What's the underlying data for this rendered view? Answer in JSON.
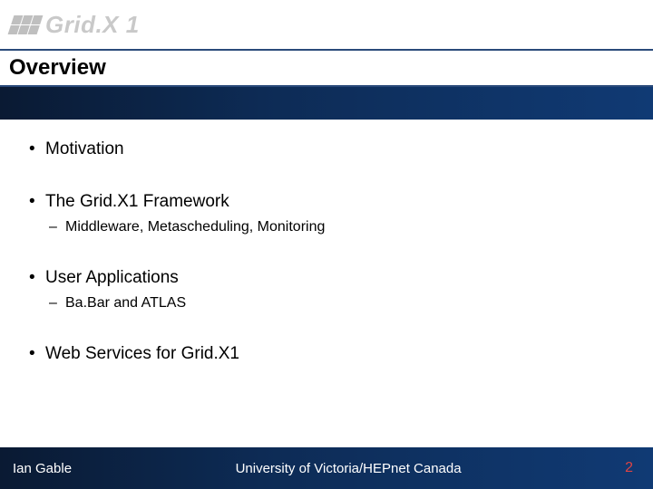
{
  "header": {
    "logo_text": "Grid.X 1"
  },
  "title": "Overview",
  "bullets": [
    {
      "text": "Motivation",
      "sub": []
    },
    {
      "text": "The Grid.X1 Framework",
      "sub": [
        "Middleware, Metascheduling, Monitoring"
      ]
    },
    {
      "text": "User Applications",
      "sub": [
        "Ba.Bar and ATLAS"
      ]
    },
    {
      "text": "Web Services for Grid.X1",
      "sub": []
    }
  ],
  "footer": {
    "author": "Ian Gable",
    "affiliation": "University of Victoria/HEPnet Canada",
    "page": "2"
  }
}
